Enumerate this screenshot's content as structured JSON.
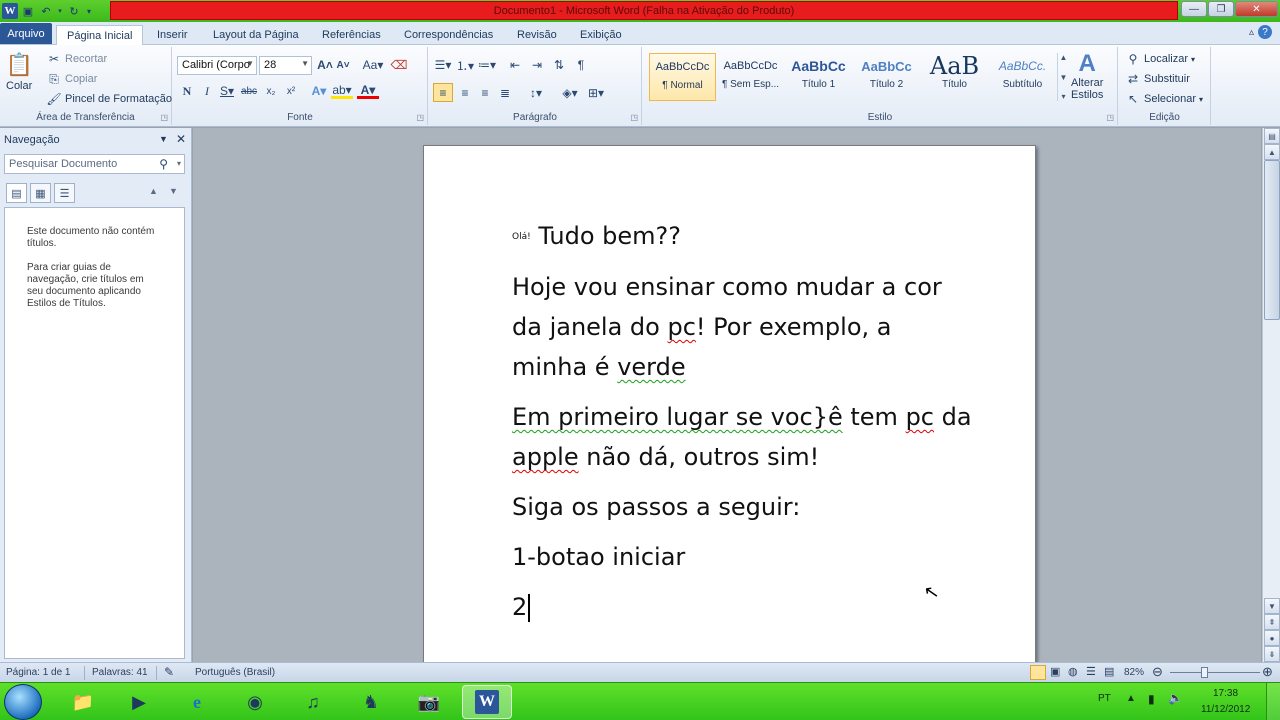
{
  "window": {
    "title": "Documento1 - Microsoft Word (Falha na Ativação do Produto)"
  },
  "tabs": [
    "Arquivo",
    "Página Inicial",
    "Inserir",
    "Layout da Página",
    "Referências",
    "Correspondências",
    "Revisão",
    "Exibição"
  ],
  "ribbon": {
    "clipboard": {
      "paste": "Colar",
      "cut": "Recortar",
      "copy": "Copiar",
      "format_painter": "Pincel de Formatação",
      "label": "Área de Transferência"
    },
    "font": {
      "name": "Calibri (Corpo",
      "size": "28",
      "label": "Fonte"
    },
    "paragraph": {
      "label": "Parágrafo"
    },
    "styles": {
      "label": "Estilo",
      "items": [
        {
          "sample": "AaBbCcDc",
          "name": "¶ Normal"
        },
        {
          "sample": "AaBbCcDc",
          "name": "¶ Sem Esp..."
        },
        {
          "sample": "AaBbCc",
          "name": "Título 1"
        },
        {
          "sample": "AaBbCc",
          "name": "Título 2"
        },
        {
          "sample": "AaB",
          "name": "Título"
        },
        {
          "sample": "AaBbCc.",
          "name": "Subtítulo"
        }
      ],
      "change_line1": "Alterar",
      "change_line2": "Estilos"
    },
    "editing": {
      "find": "Localizar",
      "replace": "Substituir",
      "select": "Selecionar",
      "label": "Edição"
    }
  },
  "nav": {
    "title": "Navegação",
    "search_placeholder": "Pesquisar Documento",
    "msg1": "Este documento não contém títulos.",
    "msg2": "Para criar guias de navegação, crie títulos em seu documento aplicando Estilos de Títulos."
  },
  "document": {
    "greeting_small": "Olá!",
    "greeting": "Tudo bem??",
    "p2_a": "Hoje vou ensinar como mudar a cor da janela do ",
    "p2_pc": "pc",
    "p2_b": "! Por exemplo, a minha é ",
    "p2_verde": "verde",
    "p3_a": "Em primeiro lugar se voc}ê",
    "p3_b": " tem ",
    "p3_pc": "pc",
    "p3_c": " da ",
    "p3_apple": "apple",
    "p3_d": " não dá, outros sim!",
    "p4": "Siga os passos a seguir:",
    "p5": "1-botao iniciar",
    "p6": "2"
  },
  "status": {
    "page": "Página: 1 de 1",
    "words": "Palavras: 41",
    "language": "Português (Brasil)",
    "zoom": "82%"
  },
  "taskbar": {
    "lang": "PT",
    "time": "17:38",
    "date": "11/12/2012"
  }
}
